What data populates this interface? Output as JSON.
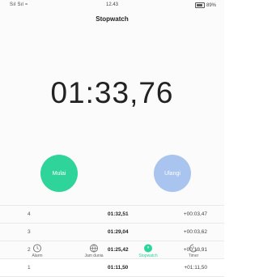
{
  "status": {
    "signal": "Sıl Sıl ≈",
    "time": "12.43",
    "battery": "89%"
  },
  "header": {
    "title": "Stopwatch"
  },
  "stopwatch": {
    "elapsed": "01:33,76"
  },
  "buttons": {
    "start": "Mulai",
    "reset": "Ulangi"
  },
  "laps": [
    {
      "num": "4",
      "time": "01:32,51",
      "diff": "+00:03,47"
    },
    {
      "num": "3",
      "time": "01:29,04",
      "diff": "+00:03,62"
    },
    {
      "num": "2",
      "time": "01:25,42",
      "diff": "+00:13,91"
    },
    {
      "num": "1",
      "time": "01:11,50",
      "diff": "+01:11,50"
    }
  ],
  "nav": {
    "alarm": "Alarm",
    "world_clock": "Jam dunia",
    "stopwatch": "Stopwatch",
    "timer": "Timer"
  },
  "colors": {
    "accent": "#2ed49a",
    "reset": "#a9c4ee"
  }
}
